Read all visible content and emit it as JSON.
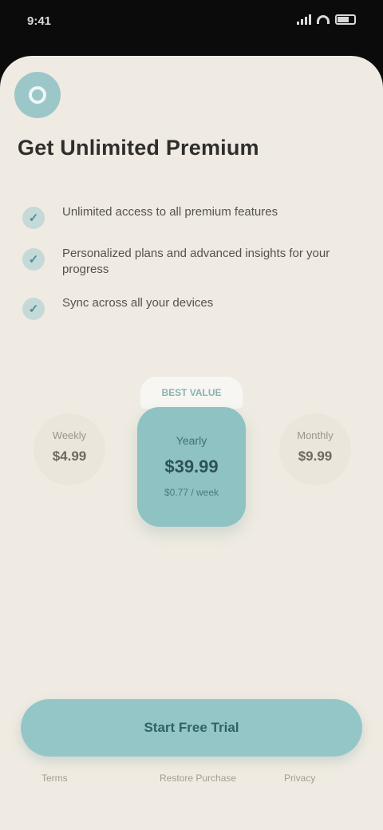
{
  "status_bar": {
    "time": "9:41"
  },
  "paywall": {
    "headline": "Get Unlimited Premium",
    "features": [
      {
        "text": "Unlimited access to all premium features"
      },
      {
        "text": "Personalized plans and advanced insights for your progress"
      },
      {
        "text": "Sync across all your devices"
      }
    ],
    "plans": {
      "left": {
        "label": "Weekly",
        "price": "$4.99"
      },
      "featured": {
        "badge": "BEST VALUE",
        "label": "Yearly",
        "price": "$39.99",
        "sub": "$0.77 / week"
      },
      "right": {
        "label": "Monthly",
        "price": "$9.99"
      }
    },
    "cta_label": "Start Free Trial",
    "footer": {
      "terms": "Terms",
      "restore": "Restore Purchase",
      "privacy": "Privacy"
    }
  },
  "colors": {
    "accent": "#94c6c8",
    "background": "#efebe2",
    "text": "#2e2e2c"
  },
  "icons": {
    "logo": "app-logo",
    "feature_check": "checkmark-icon"
  }
}
